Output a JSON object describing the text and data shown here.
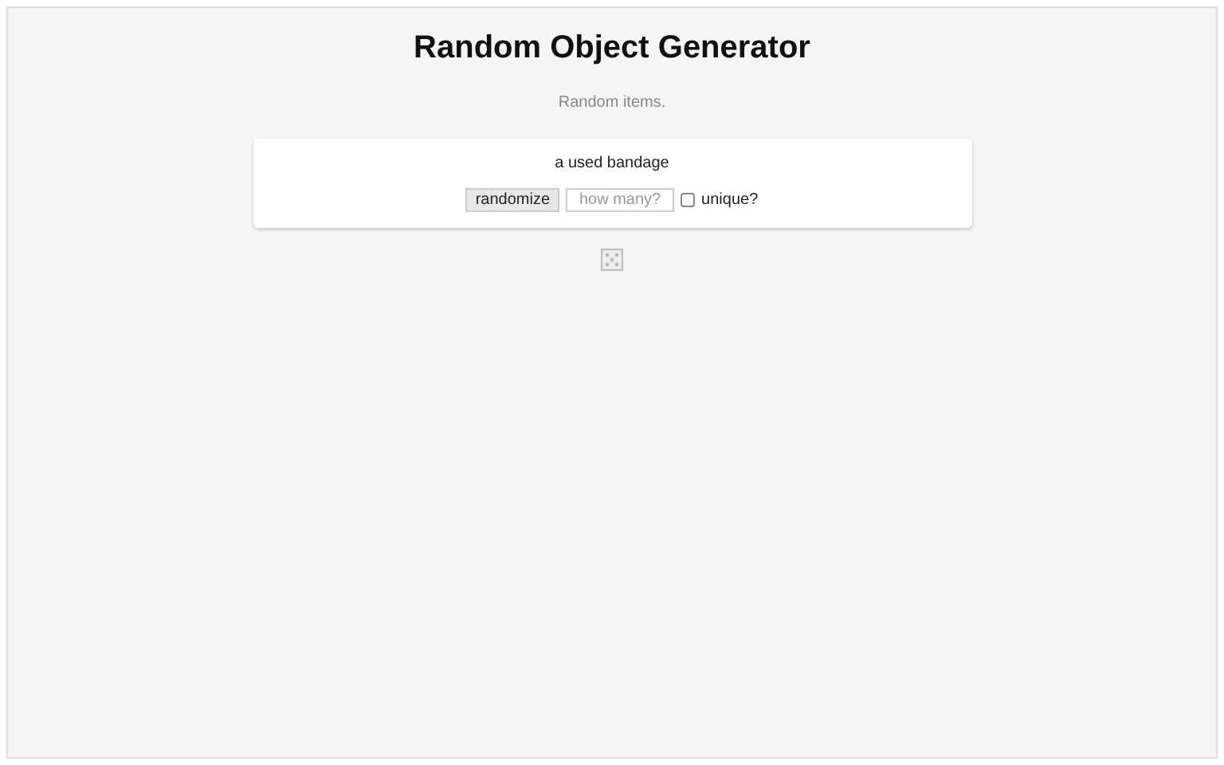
{
  "title": "Random Object Generator",
  "subtitle": "Random items.",
  "result": "a used bandage",
  "controls": {
    "button": "randomize",
    "count": {
      "placeholder": "how many?"
    },
    "unique": {
      "label": "unique?",
      "checked": false
    }
  }
}
